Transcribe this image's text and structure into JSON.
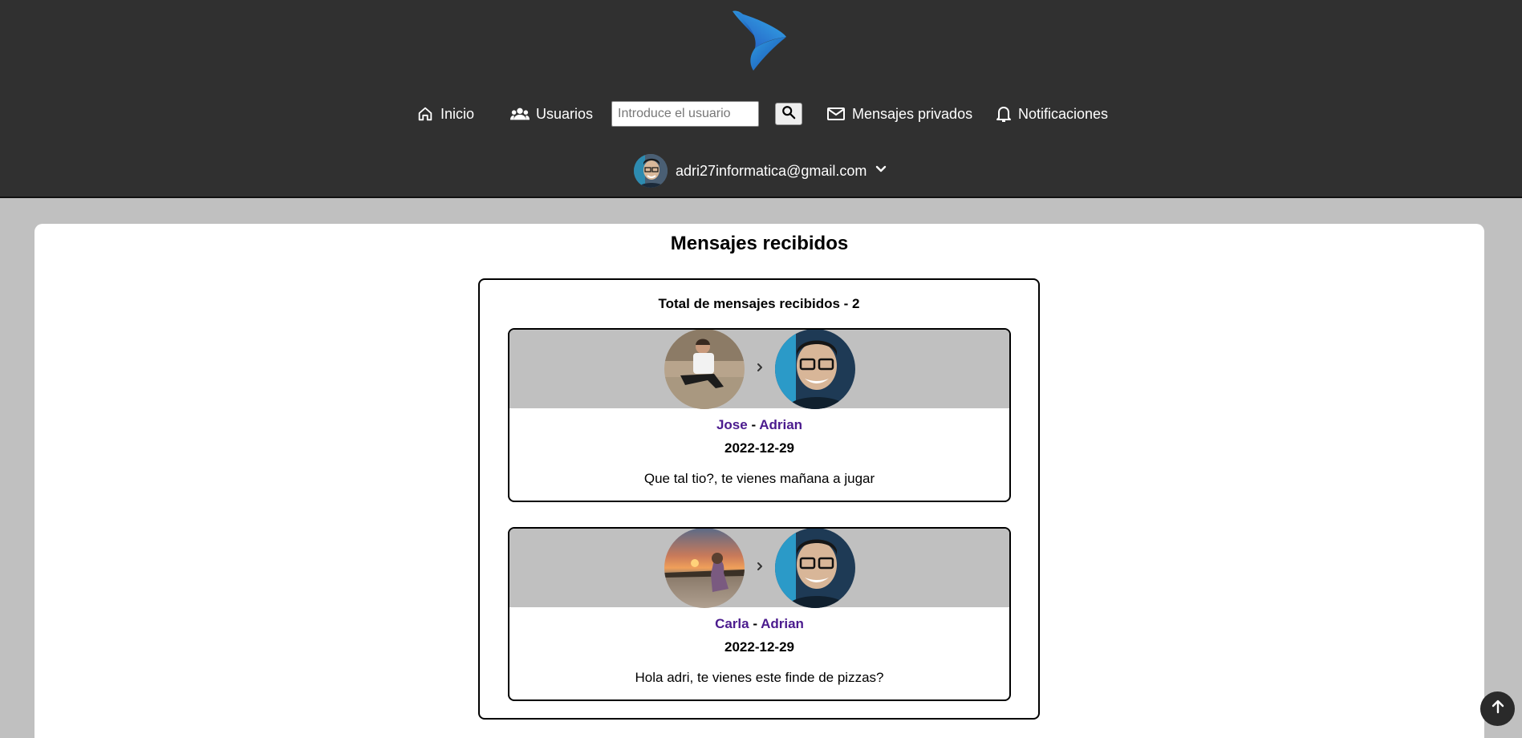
{
  "header": {
    "logo": "app-logo",
    "nav": {
      "home_label": "Inicio",
      "users_label": "Usuarios",
      "search_placeholder": "Introduce el usuario",
      "search_value": "",
      "messages_label": "Mensajes privados",
      "notifications_label": "Notificaciones"
    },
    "user": {
      "email": "adri27informatica@gmail.com"
    }
  },
  "main": {
    "title": "Mensajes recibidos",
    "total_label": "Total de mensajes recibidos - 2",
    "messages": [
      {
        "from": "Jose",
        "separator": "-",
        "to": "Adrian",
        "date": "2022-12-29",
        "text": "Que tal tio?, te vienes mañana a jugar"
      },
      {
        "from": "Carla",
        "separator": "-",
        "to": "Adrian",
        "date": "2022-12-29",
        "text": "Hola adri, te vienes este finde de pizzas?"
      }
    ]
  },
  "colors": {
    "header_bg": "#303030",
    "page_bg": "#c0c0c0",
    "name_link": "#4b1b8e"
  }
}
